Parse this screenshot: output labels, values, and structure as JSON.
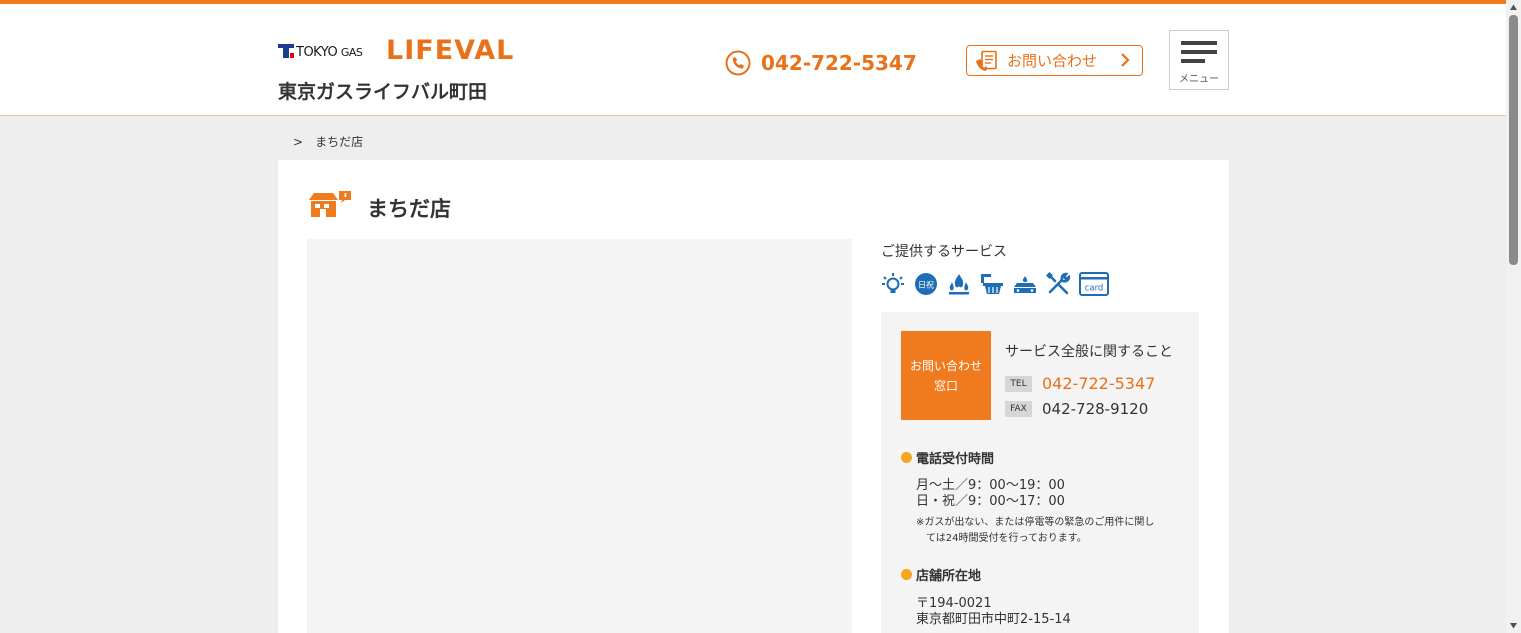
{
  "header": {
    "logo_tokyo": "TOKYO",
    "logo_gas": "GAS",
    "logo_lifeval": "LIFEVAL",
    "store_name": "東京ガスライフバル町田",
    "phone": "042-722-5347",
    "contact_label": "お問い合わせ",
    "menu_label": "メニュー"
  },
  "breadcrumb": {
    "separator": ">",
    "current": "まちだ店"
  },
  "page": {
    "title": "まちだ店"
  },
  "services": {
    "heading": "ご提供するサービス",
    "icons": [
      "lightbulb-icon",
      "daily-life-icon",
      "gas-flame-icon",
      "bathroom-icon",
      "gas-stove-icon",
      "repair-tools-icon",
      "card-icon"
    ],
    "day_badge_text": "日祝",
    "card_badge_text": "card"
  },
  "contact": {
    "box_line1": "お問い合わせ",
    "box_line2": "窓口",
    "description": "サービス全般に関すること",
    "tel_tag": "TEL",
    "tel": "042-722-5347",
    "fax_tag": "FAX",
    "fax": "042-728-9120"
  },
  "hours": {
    "heading": "電話受付時間",
    "line1": "月〜土／9：00〜19：00",
    "line2": "日・祝／9：00〜17：00",
    "note_line1": "※ガスが出ない、または停電等の緊急のご用件に関し",
    "note_line2": "ては24時間受付を行っております。"
  },
  "address": {
    "heading": "店舗所在地",
    "postal": "〒194-0021",
    "street": "東京都町田市中町2-15-14"
  },
  "colors": {
    "accent": "#f07a1e",
    "service_icon": "#1e6eb5",
    "panel": "#f4f4f4",
    "page_bg": "#eeeeee"
  }
}
